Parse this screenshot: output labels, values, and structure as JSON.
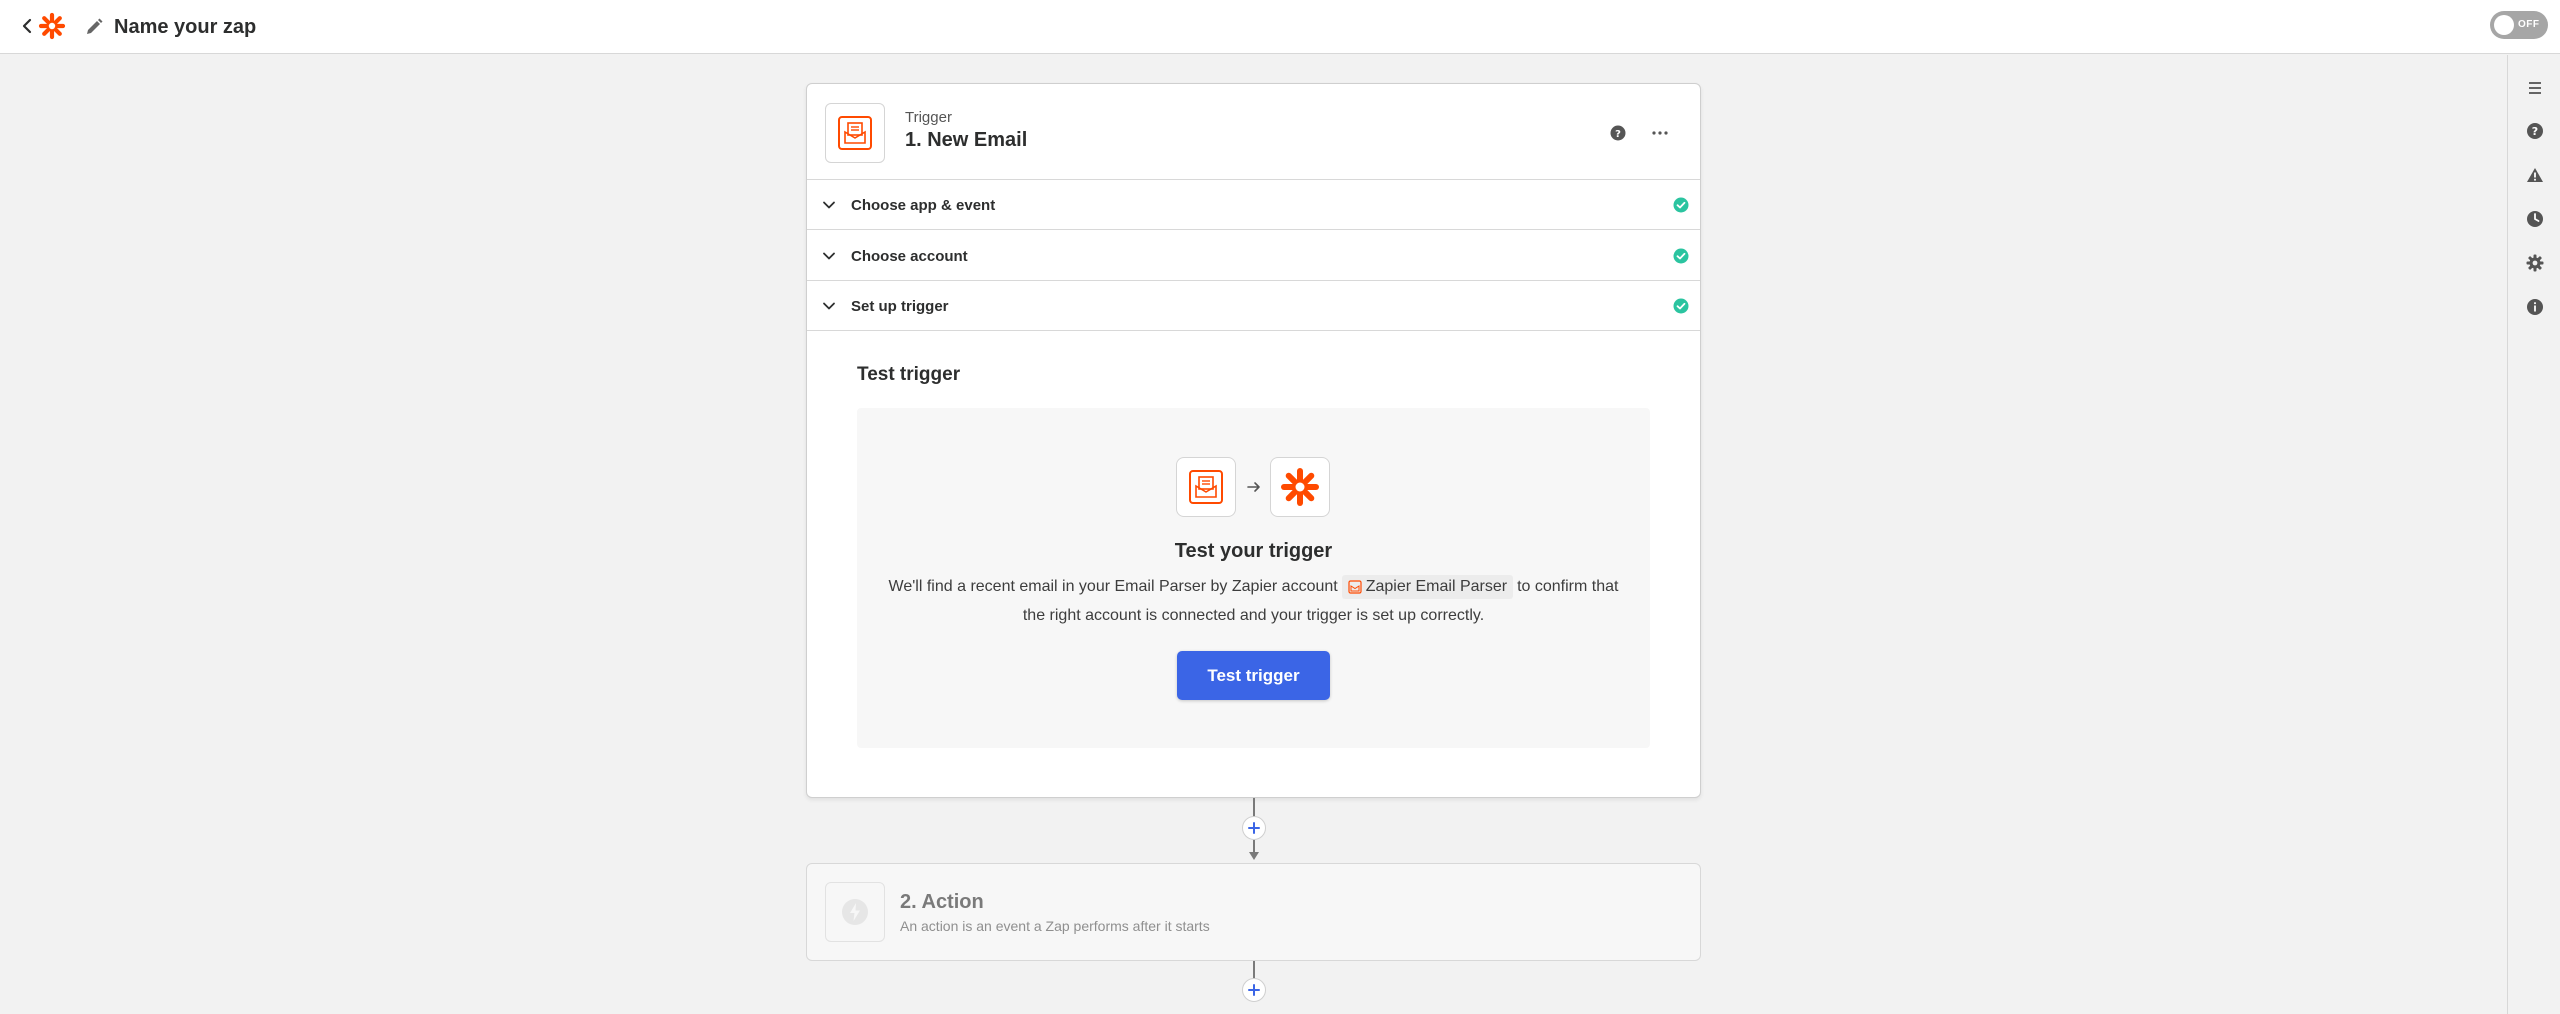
{
  "topbar": {
    "zap_name": "Name your zap",
    "toggle_label": "OFF"
  },
  "trigger": {
    "kind": "Trigger",
    "title": "1. New Email",
    "sections": [
      {
        "label": "Choose app & event"
      },
      {
        "label": "Choose account"
      },
      {
        "label": "Set up trigger"
      }
    ],
    "test_heading": "Test trigger",
    "panel_title": "Test your trigger",
    "desc_before": "We'll find a recent email in your Email Parser by Zapier account",
    "account_chip": "Zapier Email Parser",
    "desc_after": "to confirm that the right account is connected and your trigger is set up correctly.",
    "button_label": "Test trigger"
  },
  "action": {
    "title": "2. Action",
    "subtitle": "An action is an event a Zap performs after it starts"
  },
  "colors": {
    "brand": "#ff4a00",
    "primary": "#3b65e6",
    "success": "#2bc4a0"
  },
  "icons": {
    "back": "chevron-left-icon",
    "logo": "zapier-asterisk-icon",
    "edit": "pencil-icon",
    "help": "question-circle-icon",
    "more": "ellipsis-icon",
    "check": "check-circle-icon",
    "rail": [
      "outline-icon",
      "help-icon",
      "warning-icon",
      "history-icon",
      "settings-icon",
      "info-icon"
    ]
  }
}
